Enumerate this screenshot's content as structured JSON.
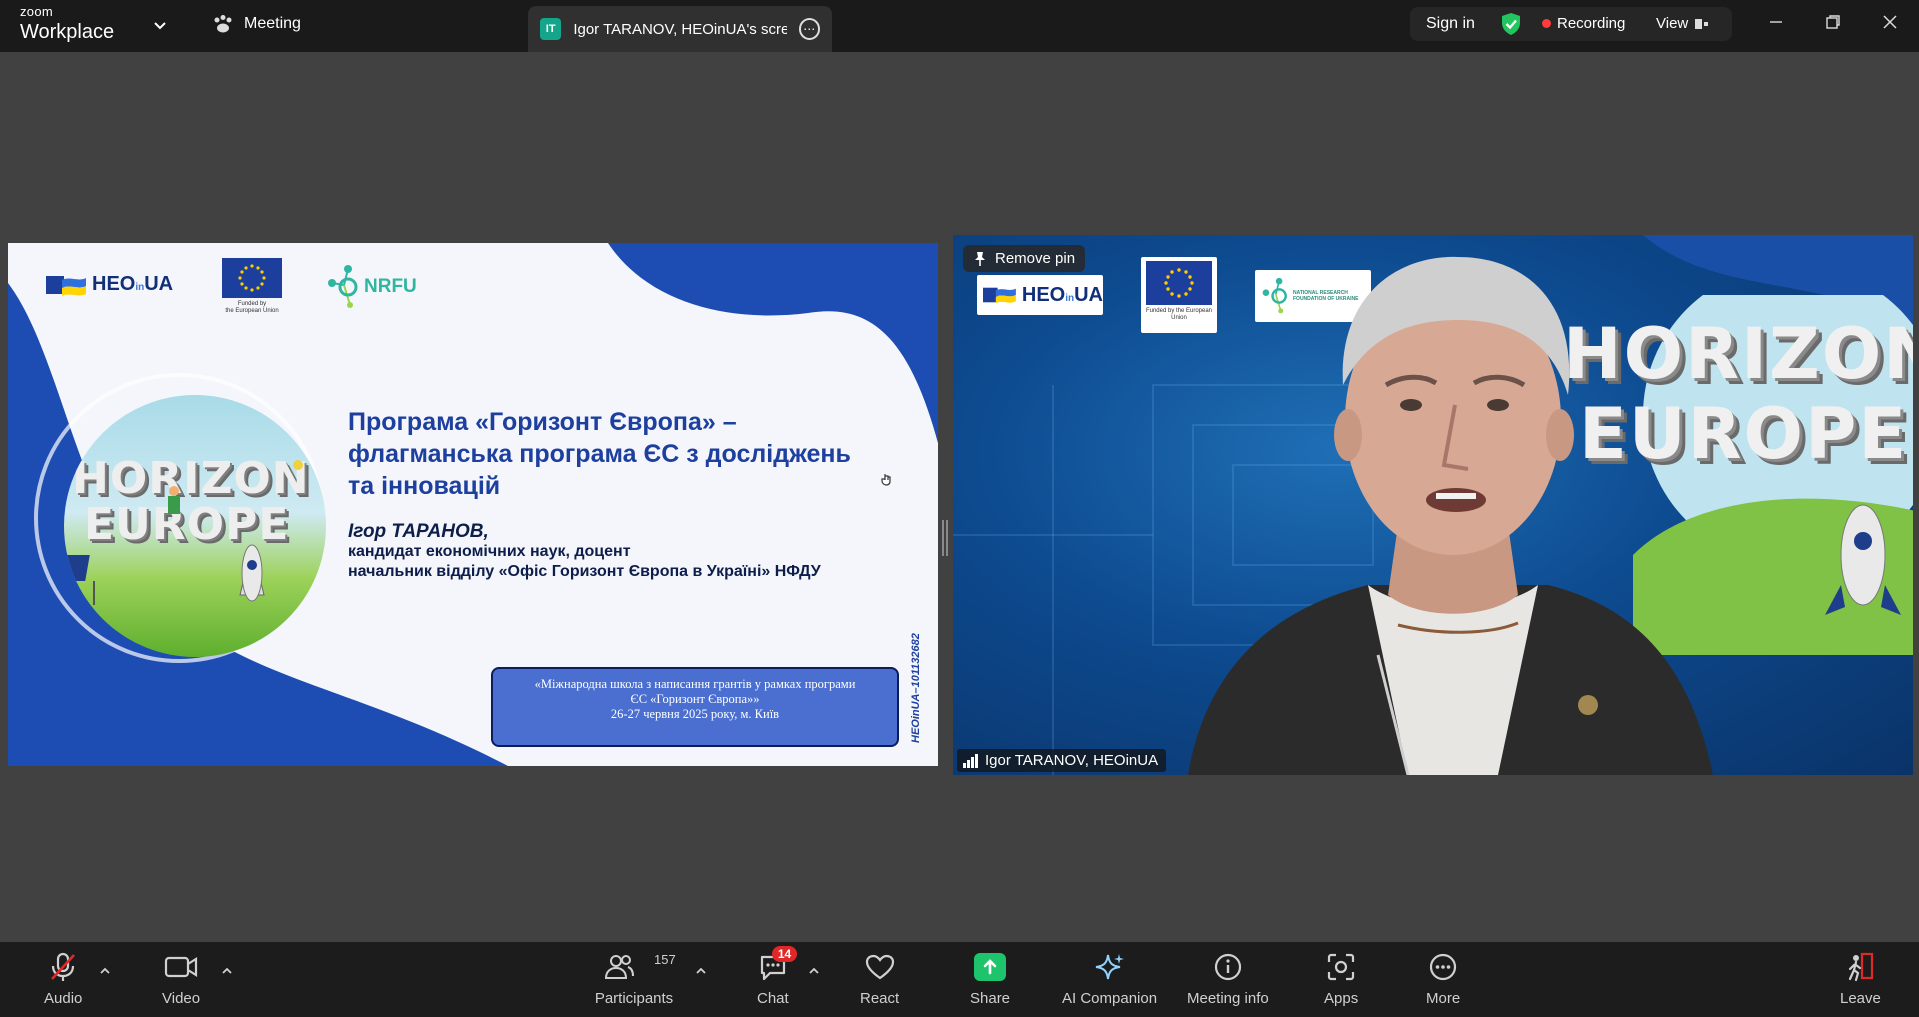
{
  "app": {
    "brand_small": "zoom",
    "brand_large": "Workplace",
    "meeting_tab_label": "Meeting",
    "share_tab_badge": "IT",
    "share_tab_title": "Igor TARANOV, HEOinUA's screen",
    "sign_in": "Sign in",
    "recording": "Recording",
    "view": "View"
  },
  "slide": {
    "heo_logo": "HEO",
    "heo_logo_in": "in",
    "heo_logo_ua": "UA",
    "eu_caption_1": "Funded by",
    "eu_caption_2": "the European Union",
    "nrfu_logo": "NRFU",
    "horizon_word_1": "HORIZON",
    "horizon_word_2": "EUROPE",
    "title": "Програма «Горизонт Європа» – флагманська програма ЄС з досліджень та інновацій",
    "author": "Ігор ТАРАНОВ,",
    "degree": "кандидат економічних наук, доцент",
    "position": "начальник відділу «Офіс Горизонт Європа в Україні» НФДУ",
    "school_line_1": "«Міжнародна школа з написання грантів у рамках програми",
    "school_line_2": "ЄС «Горизонт Європа»»",
    "school_line_3": "26-27 червня 2025 року, м. Київ",
    "project_id": "HEOinUA–101132682"
  },
  "video": {
    "remove_pin": "Remove pin",
    "heo_logo": "HEO",
    "heo_logo_ua": "UA",
    "eu_caption": "Funded by the European Union",
    "nrf_caption": "NATIONAL RESEARCH FOUNDATION OF UKRAINE",
    "horizon_word_1": "HORIZON",
    "horizon_word_2": "EUROPE",
    "participant_name": "Igor TARANOV, HEOinUA"
  },
  "toolbar": {
    "audio": "Audio",
    "video": "Video",
    "participants": "Participants",
    "participants_count": "157",
    "chat": "Chat",
    "chat_badge": "14",
    "react": "React",
    "share": "Share",
    "ai_companion": "AI Companion",
    "meeting_info": "Meeting info",
    "apps": "Apps",
    "more": "More",
    "leave": "Leave"
  },
  "colors": {
    "recording_dot": "#ff3b3b",
    "share_green": "#1ec46b",
    "shield_green": "#22c55e",
    "chat_badge_red": "#e02828",
    "slide_blue": "#1d3f9e"
  }
}
